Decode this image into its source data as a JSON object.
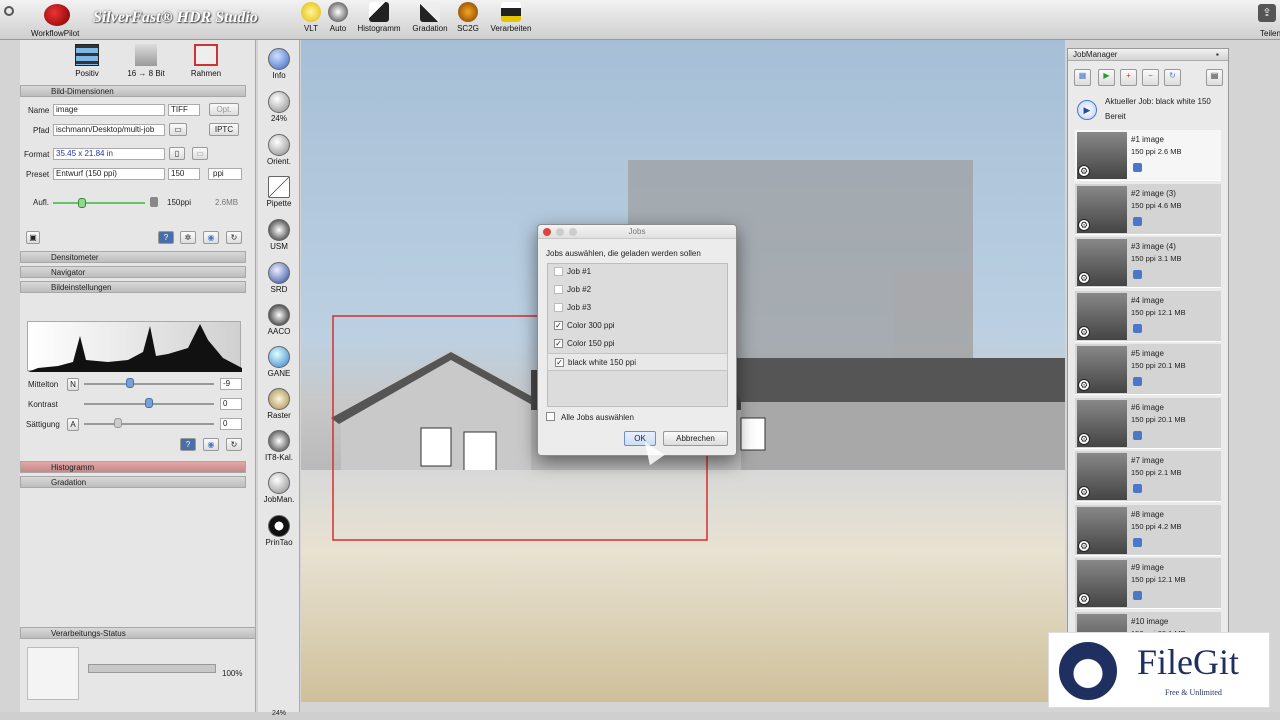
{
  "app": {
    "title": "SilverFast® HDR Studio",
    "workflow_label": "WorkflowPilot"
  },
  "toolbar": {
    "items": [
      {
        "label": "VLT"
      },
      {
        "label": "Auto"
      },
      {
        "label": "Histogramm"
      },
      {
        "label": "Gradation"
      },
      {
        "label": "SC2G"
      },
      {
        "label": "Verarbeiten"
      }
    ],
    "share_label": "Teilen"
  },
  "modes": {
    "positiv": "Positiv",
    "bit": "16 → 8 Bit",
    "rahmen": "Rahmen"
  },
  "bild_dimensionen": {
    "section_title": "Bild-Dimensionen",
    "name_label": "Name",
    "name_value": "image",
    "format_value": "TIFF",
    "opt_label": "Opt.",
    "pfad_label": "Pfad",
    "pfad_value": "ischmann/Desktop/multi-job",
    "iptc_label": "IPTC",
    "format_label": "Format",
    "format_dims": "35.45 x 21.84 in",
    "preset_label": "Preset",
    "preset_value": "Entwurf (150 ppi)",
    "ppi_value": "150",
    "ppi_unit": "ppi",
    "aufl_label": "Aufl.",
    "aufl_value": "150ppi",
    "aufl_size": "2.6MB"
  },
  "sections": {
    "densitometer": "Densitometer",
    "navigator": "Navigator",
    "bildeinstellungen": "Bildeinstellungen",
    "histogramm": "Histogramm",
    "gradation": "Gradation",
    "verarbeitung": "Verarbeitungs-Status"
  },
  "adjust": {
    "mittelton_label": "Mittelton",
    "mittelton_btn": "N",
    "mittelton_value": "-9",
    "kontrast_label": "Kontrast",
    "kontrast_value": "0",
    "saettigung_label": "Sättigung",
    "saettigung_btn": "A",
    "saettigung_value": "0"
  },
  "status": {
    "percent": "100%",
    "progress": 1.0
  },
  "tools": [
    {
      "label": "Info"
    },
    {
      "label": "24%"
    },
    {
      "label": "Orient."
    },
    {
      "label": "Pipette"
    },
    {
      "label": "USM"
    },
    {
      "label": "SRD"
    },
    {
      "label": "AACO"
    },
    {
      "label": "GANE"
    },
    {
      "label": "Raster"
    },
    {
      "label": "IT8-Kal."
    },
    {
      "label": "JobMan."
    },
    {
      "label": "PrinTao"
    }
  ],
  "zoom_footer": "24%",
  "jobmanager": {
    "title": "JobManager",
    "current_job": "Aktueller Job: black white 150",
    "status": "Bereit",
    "jobs": [
      {
        "name": "#1 image",
        "spec": "150 ppi   2.6 MB"
      },
      {
        "name": "#2 image (3)",
        "spec": "150 ppi   4.6 MB"
      },
      {
        "name": "#3 image (4)",
        "spec": "150 ppi   3.1 MB"
      },
      {
        "name": "#4 image",
        "spec": "150 ppi   12.1 MB"
      },
      {
        "name": "#5 image",
        "spec": "150 ppi   20.1 MB"
      },
      {
        "name": "#6 image",
        "spec": "150 ppi   20.1 MB"
      },
      {
        "name": "#7 image",
        "spec": "150 ppi   2.1 MB"
      },
      {
        "name": "#8 image",
        "spec": "150 ppi   4.2 MB"
      },
      {
        "name": "#9 image",
        "spec": "150 ppi   12.1 MB"
      },
      {
        "name": "#10 image",
        "spec": "150 ppi   20.1 MB"
      }
    ]
  },
  "dialog": {
    "title": "Jobs",
    "prompt": "Jobs auswählen, die geladen werden sollen",
    "items": [
      {
        "label": "Job #1",
        "checked": false
      },
      {
        "label": "Job #2",
        "checked": false
      },
      {
        "label": "Job #3",
        "checked": false
      },
      {
        "label": "Color 300 ppi",
        "checked": true
      },
      {
        "label": "Color 150 ppi",
        "checked": true
      },
      {
        "label": "black white 150 ppi",
        "checked": true
      }
    ],
    "select_all_label": "Alle Jobs auswählen",
    "ok_label": "OK",
    "cancel_label": "Abbrechen"
  },
  "watermark": {
    "brand": "FileGit",
    "tagline": "Free & Unlimited"
  },
  "colors": {
    "accent": "#4a78c8",
    "selection": "#d23030"
  }
}
